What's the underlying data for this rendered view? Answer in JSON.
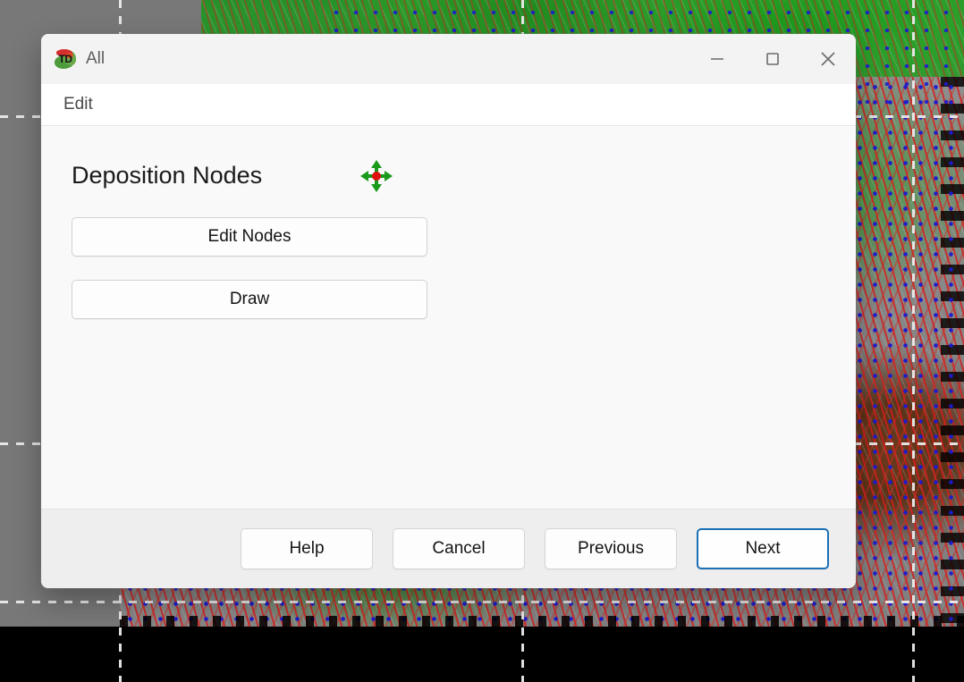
{
  "background": {
    "description": "CAD terrain viewport with contour lines and node grid",
    "canvas_color": "#787878",
    "terrain_green": "#2a9a28",
    "contour_color": "#d61c1c",
    "node_color": "#1a1ad0",
    "guide_color": "#ebebeb",
    "void_color": "#000000"
  },
  "window": {
    "title": "All",
    "icon_name": "app-logo-td",
    "icon_text": "TD",
    "controls": {
      "minimize": "minimize-icon",
      "maximize": "maximize-icon",
      "close": "close-icon"
    }
  },
  "menubar": {
    "items": [
      {
        "label": "Edit"
      }
    ]
  },
  "main": {
    "section_title": "Deposition Nodes",
    "decoration_icon": "move-node-icon",
    "decoration_icon_colors": {
      "arrows": "#1a9a1a",
      "center_dot": "#e01010"
    },
    "buttons": [
      {
        "label": "Edit Nodes",
        "name": "edit-nodes-button"
      },
      {
        "label": "Draw",
        "name": "draw-button"
      }
    ]
  },
  "footer": {
    "buttons": [
      {
        "label": "Help",
        "name": "help-button",
        "default": false
      },
      {
        "label": "Cancel",
        "name": "cancel-button",
        "default": false
      },
      {
        "label": "Previous",
        "name": "previous-button",
        "default": false
      },
      {
        "label": "Next",
        "name": "next-button",
        "default": true
      }
    ],
    "default_button_accent": "#1a6fb5"
  }
}
